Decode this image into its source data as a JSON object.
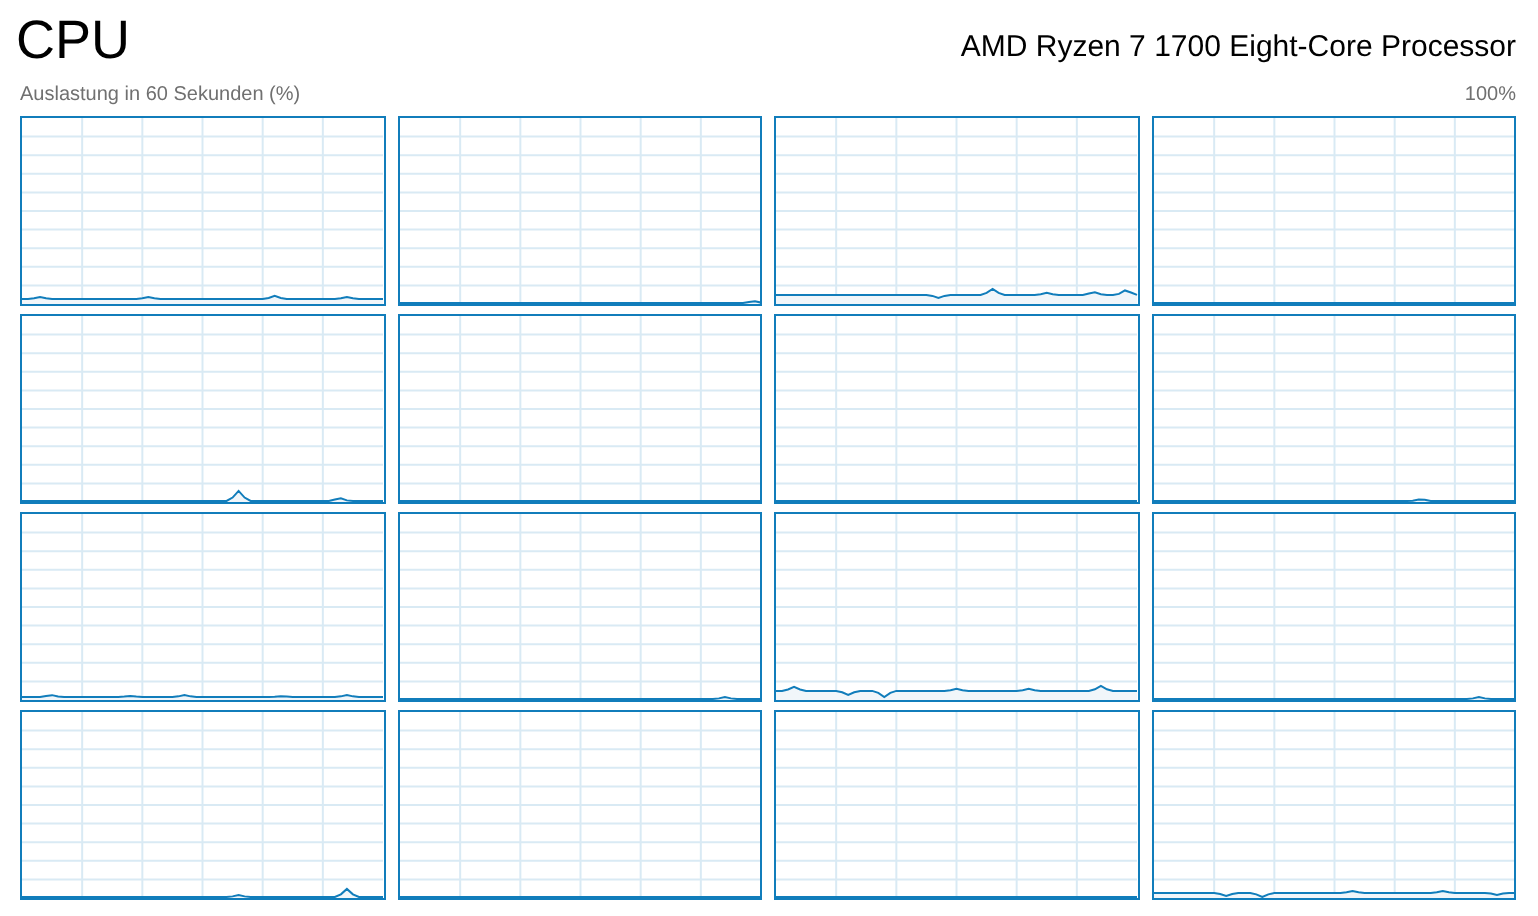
{
  "title": "CPU",
  "processor": "AMD Ryzen 7 1700 Eight-Core Processor",
  "axis_label": "Auslastung in 60 Sekunden (%)",
  "max_label": "100%",
  "graphs": [
    {
      "kind": "graph"
    },
    {
      "kind": "graph"
    },
    {
      "kind": "graph"
    },
    {
      "kind": "graph"
    },
    {
      "kind": "graph"
    },
    {
      "kind": "graph"
    },
    {
      "kind": "graph"
    },
    {
      "kind": "graph"
    },
    {
      "kind": "graph"
    },
    {
      "kind": "graph"
    },
    {
      "kind": "graph"
    },
    {
      "kind": "graph"
    },
    {
      "kind": "graph"
    },
    {
      "kind": "graph"
    },
    {
      "kind": "graph"
    },
    {
      "kind": "graph"
    }
  ]
}
